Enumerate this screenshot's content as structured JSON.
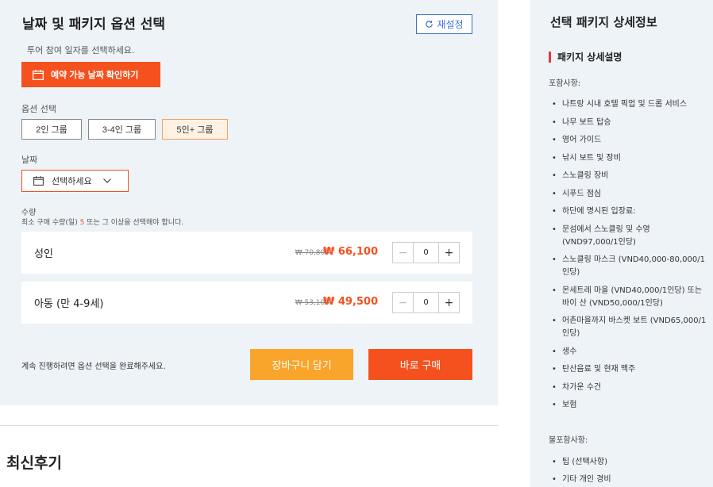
{
  "options": {
    "title": "날짜 및 패키지 옵션 선택",
    "reset_label": "재설정",
    "tour_hint": "투어 참여 일자를 선택하세요.",
    "check_dates_label": "예약 가능 날짜 확인하기",
    "option_label": "옵션 선택",
    "groups": [
      "2인 그룹",
      "3-4인 그룹",
      "5인+ 그룹"
    ],
    "selected_group": "5인+ 그룹",
    "date_label": "날짜",
    "date_placeholder": "선택하세요",
    "qty_label": "수량",
    "qty_hint_before": "최소 구매 수량(일) ",
    "qty_min": "5",
    "qty_hint_after": " 또는 그 이상을 선택해야 합니다.",
    "rows": [
      {
        "name": "성인",
        "original_price": "₩ 70,800",
        "price": "₩ 66,100",
        "quantity": "0"
      },
      {
        "name": "아동 (만 4-9세)",
        "original_price": "₩ 53,100",
        "price": "₩ 49,500",
        "quantity": "0"
      }
    ],
    "continue_hint": "계속 진행하려면 옵션 선택을 완료해주세요.",
    "cart_label": "장바구니 담기",
    "buy_label": "바로 구매"
  },
  "reviews": {
    "title": "최신후기"
  },
  "details": {
    "title": "선택 패키지 상세정보",
    "section_title": "패키지 상세설명",
    "included_label": "포함사항:",
    "included": [
      "나트랑 시내 호텔 픽업 및 드롭 서비스",
      "나무 보트 탑승",
      "영어 가이드",
      "낚시 보트 및 장비",
      "스노클링 장비",
      "시푸드 점심",
      "하단에 명시된 입장료:",
      "문섬에서 스노클링 및 수영 (VND97,000/1인당)",
      "스노클링 마스크 (VND40,000-80,000/1인당)",
      "몬세트레 마을 (VND40,000/1인당) 또는 바이 산 (VND50,000/1인당)",
      "어촌마을까지 바스켓 보트 (VND65,000/1인당)",
      "생수",
      "탄산음료 및 현재 맥주",
      "차가운 수건",
      "보험"
    ],
    "excluded_label": "불포함사항:",
    "excluded": [
      "팁 (선택사항)",
      "기타 개인 경비"
    ]
  },
  "colors": {
    "accent_orange": "#f4511e",
    "cart_yellow": "#f9a42a",
    "reset_blue": "#3b6fd4",
    "section_red": "#e03a3a"
  }
}
